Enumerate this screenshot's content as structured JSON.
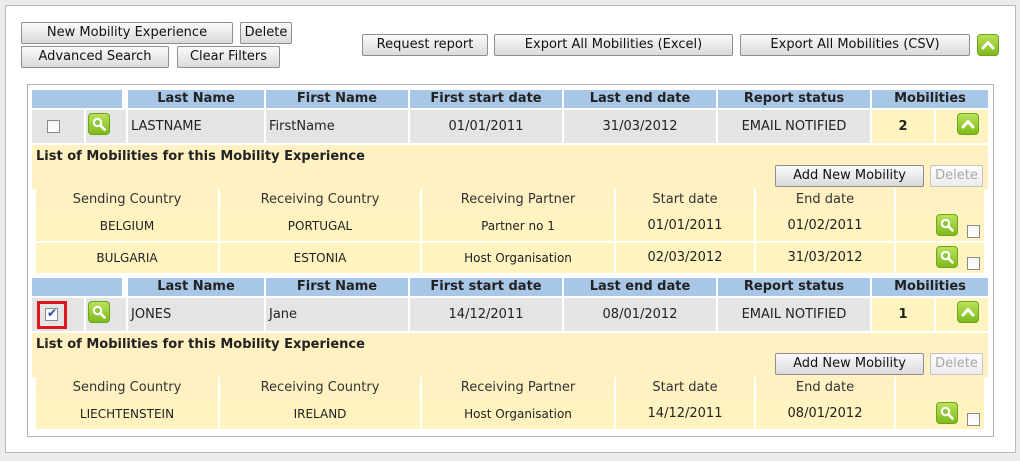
{
  "toolbar": {
    "new_mobility_experience": "New Mobility Experience",
    "delete": "Delete",
    "advanced_search": "Advanced Search",
    "clear_filters": "Clear Filters",
    "request_report": "Request report",
    "export_excel": "Export All Mobilities (Excel)",
    "export_csv": "Export All Mobilities (CSV)"
  },
  "columns": {
    "last_name": "Last Name",
    "first_name": "First Name",
    "first_start_date": "First start date",
    "last_end_date": "Last end date",
    "report_status": "Report status",
    "mobilities": "Mobilities"
  },
  "sub_columns": {
    "sending_country": "Sending Country",
    "receiving_country": "Receiving Country",
    "receiving_partner": "Receiving Partner",
    "start_date": "Start date",
    "end_date": "End date"
  },
  "experiences": [
    {
      "last_name": "LASTNAME",
      "first_name": "FirstName",
      "first_start_date": "01/01/2011",
      "last_end_date": "31/03/2012",
      "report_status": "EMAIL NOTIFIED",
      "mobilities": "2",
      "checked": false,
      "list_title": "List of Mobilities for this Mobility Experience",
      "add_new_mobility": "Add New Mobility",
      "delete": "Delete",
      "rows": [
        {
          "sending_country": "BELGIUM",
          "receiving_country": "PORTUGAL",
          "receiving_partner": "Partner no 1",
          "start_date": "01/01/2011",
          "end_date": "01/02/2011"
        },
        {
          "sending_country": "BULGARIA",
          "receiving_country": "ESTONIA",
          "receiving_partner": "Host Organisation",
          "start_date": "02/03/2012",
          "end_date": "31/03/2012"
        }
      ]
    },
    {
      "last_name": "JONES",
      "first_name": "Jane",
      "first_start_date": "14/12/2011",
      "last_end_date": "08/01/2012",
      "report_status": "EMAIL NOTIFIED",
      "mobilities": "1",
      "checked": true,
      "list_title": "List of Mobilities for this Mobility Experience",
      "add_new_mobility": "Add New Mobility",
      "delete": "Delete",
      "rows": [
        {
          "sending_country": "LIECHTENSTEIN",
          "receiving_country": "IRELAND",
          "receiving_partner": "Host Organisation",
          "start_date": "14/12/2011",
          "end_date": "08/01/2012"
        }
      ]
    }
  ],
  "colors": {
    "header_blue": "#a8c6e6",
    "row_grey": "#e4e4e4",
    "sub_yellow": "#fff3c0",
    "accent_green": "#8cc63f",
    "highlight_red": "#e0151e"
  },
  "icons": {
    "view": "magnifier-icon",
    "collapse": "chevron-up-icon"
  }
}
